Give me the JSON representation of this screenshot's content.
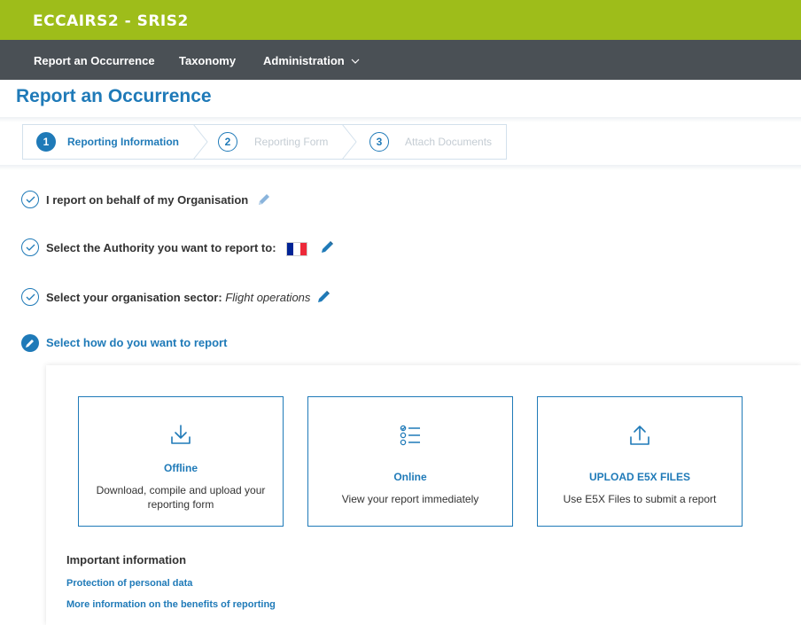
{
  "app": {
    "brand": "ECCAIRS2 - SRIS2"
  },
  "nav": {
    "items": [
      {
        "label": "Report an Occurrence"
      },
      {
        "label": "Taxonomy"
      },
      {
        "label": "Administration",
        "icon": "chevron-down-icon"
      }
    ]
  },
  "page": {
    "title": "Report an Occurrence"
  },
  "stepper": {
    "steps": [
      {
        "number": "1",
        "label": "Reporting Information",
        "state": "active"
      },
      {
        "number": "2",
        "label": "Reporting Form",
        "state": "inactive"
      },
      {
        "number": "3",
        "label": "Attach Documents",
        "state": "inactive"
      }
    ]
  },
  "sections": {
    "behalf": {
      "label": "I report on behalf of my Organisation",
      "status": "completed"
    },
    "authority": {
      "label": "Select the Authority you want to report to:",
      "flag": "France",
      "status": "completed"
    },
    "sector": {
      "label": "Select your organisation sector:",
      "value": "Flight operations",
      "status": "completed"
    },
    "how": {
      "label": "Select how do you want to report",
      "status": "editing"
    }
  },
  "options": [
    {
      "title": "Offline",
      "description": "Download, compile and upload your reporting form",
      "icon": "download-icon"
    },
    {
      "title": "Online",
      "description": "View your report immediately",
      "icon": "checklist-icon"
    },
    {
      "title": "UPLOAD E5X FILES",
      "description": "Use E5X Files to submit a report",
      "icon": "upload-icon"
    }
  ],
  "info": {
    "heading": "Important information",
    "links": [
      {
        "label": "Protection of personal data"
      },
      {
        "label": "More information on the benefits of reporting"
      }
    ]
  },
  "colors": {
    "brand_green": "#9ebd1a",
    "nav_dark": "#4a5055",
    "accent_blue": "#1f7ab8",
    "flag_blue": "#002395",
    "flag_red": "#ed2939"
  }
}
